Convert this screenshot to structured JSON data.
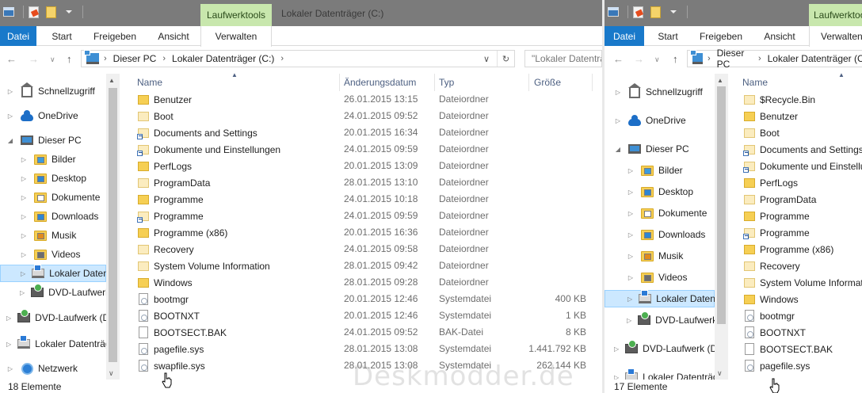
{
  "left": {
    "context_tab": "Laufwerktools",
    "window_title": "Lokaler Datenträger (C:)",
    "ribbon_tabs": [
      "Datei",
      "Start",
      "Freigeben",
      "Ansicht",
      "Verwalten"
    ],
    "breadcrumb": [
      "Dieser PC",
      "Lokaler Datenträger (C:)"
    ],
    "search_placeholder": "\"Lokaler Datenträger (C:)\" durchsuchen",
    "nav": [
      {
        "label": "Schnellzugriff",
        "icon": "home-icon"
      },
      {
        "label": "OneDrive",
        "icon": "onedrive-icon"
      },
      {
        "label": "Dieser PC",
        "icon": "pc-icon"
      },
      {
        "label": "Bilder",
        "icon": "pictures-folder-icon"
      },
      {
        "label": "Desktop",
        "icon": "desktop-folder-icon"
      },
      {
        "label": "Dokumente",
        "icon": "documents-folder-icon"
      },
      {
        "label": "Downloads",
        "icon": "downloads-folder-icon"
      },
      {
        "label": "Musik",
        "icon": "music-folder-icon"
      },
      {
        "label": "Videos",
        "icon": "videos-folder-icon"
      },
      {
        "label": "Lokaler Datenträger (C:)",
        "icon": "drive-icon"
      },
      {
        "label": "DVD-Laufwerk (D:)",
        "icon": "dvd-drive-icon"
      },
      {
        "label": "DVD-Laufwerk (D:)",
        "icon": "dvd-drive-icon"
      },
      {
        "label": "Lokaler Datenträger (C:)",
        "icon": "drive-icon"
      },
      {
        "label": "Netzwerk",
        "icon": "network-icon"
      }
    ],
    "columns": {
      "name": "Name",
      "date": "Änderungsdatum",
      "type": "Typ",
      "size": "Größe"
    },
    "files": [
      {
        "name": "Benutzer",
        "date": "26.01.2015 13:15",
        "type": "Dateiordner",
        "size": "",
        "icon": "folder-icon"
      },
      {
        "name": "Boot",
        "date": "24.01.2015 09:52",
        "type": "Dateiordner",
        "size": "",
        "icon": "folder-pale-icon"
      },
      {
        "name": "Documents and Settings",
        "date": "20.01.2015 16:34",
        "type": "Dateiordner",
        "size": "",
        "icon": "junction-icon"
      },
      {
        "name": "Dokumente und Einstellungen",
        "date": "24.01.2015 09:59",
        "type": "Dateiordner",
        "size": "",
        "icon": "junction-icon"
      },
      {
        "name": "PerfLogs",
        "date": "20.01.2015 13:09",
        "type": "Dateiordner",
        "size": "",
        "icon": "folder-icon"
      },
      {
        "name": "ProgramData",
        "date": "28.01.2015 13:10",
        "type": "Dateiordner",
        "size": "",
        "icon": "folder-pale-icon"
      },
      {
        "name": "Programme",
        "date": "24.01.2015 10:18",
        "type": "Dateiordner",
        "size": "",
        "icon": "folder-icon"
      },
      {
        "name": "Programme",
        "date": "24.01.2015 09:59",
        "type": "Dateiordner",
        "size": "",
        "icon": "junction-icon"
      },
      {
        "name": "Programme (x86)",
        "date": "20.01.2015 16:36",
        "type": "Dateiordner",
        "size": "",
        "icon": "folder-icon"
      },
      {
        "name": "Recovery",
        "date": "24.01.2015 09:58",
        "type": "Dateiordner",
        "size": "",
        "icon": "folder-pale-icon"
      },
      {
        "name": "System Volume Information",
        "date": "28.01.2015 09:42",
        "type": "Dateiordner",
        "size": "",
        "icon": "folder-pale-icon"
      },
      {
        "name": "Windows",
        "date": "28.01.2015 09:28",
        "type": "Dateiordner",
        "size": "",
        "icon": "folder-icon"
      },
      {
        "name": "bootmgr",
        "date": "20.01.2015 12:46",
        "type": "Systemdatei",
        "size": "400 KB",
        "icon": "system-file-icon"
      },
      {
        "name": "BOOTNXT",
        "date": "20.01.2015 12:46",
        "type": "Systemdatei",
        "size": "1 KB",
        "icon": "system-file-icon"
      },
      {
        "name": "BOOTSECT.BAK",
        "date": "24.01.2015 09:52",
        "type": "BAK-Datei",
        "size": "8 KB",
        "icon": "file-icon"
      },
      {
        "name": "pagefile.sys",
        "date": "28.01.2015 13:08",
        "type": "Systemdatei",
        "size": "1.441.792 KB",
        "icon": "system-file-icon"
      },
      {
        "name": "swapfile.sys",
        "date": "28.01.2015 13:08",
        "type": "Systemdatei",
        "size": "262.144 KB",
        "icon": "system-file-icon"
      }
    ],
    "status": "18 Elemente"
  },
  "right": {
    "context_tab": "Laufwerktools",
    "ribbon_tabs": [
      "Datei",
      "Start",
      "Freigeben",
      "Ansicht",
      "Verwalten"
    ],
    "breadcrumb": [
      "Dieser PC",
      "Lokaler Datenträger (C:)"
    ],
    "nav": [
      {
        "label": "Schnellzugriff",
        "icon": "home-icon"
      },
      {
        "label": "OneDrive",
        "icon": "onedrive-icon"
      },
      {
        "label": "Dieser PC",
        "icon": "pc-icon"
      },
      {
        "label": "Bilder",
        "icon": "pictures-folder-icon"
      },
      {
        "label": "Desktop",
        "icon": "desktop-folder-icon"
      },
      {
        "label": "Dokumente",
        "icon": "documents-folder-icon"
      },
      {
        "label": "Downloads",
        "icon": "downloads-folder-icon"
      },
      {
        "label": "Musik",
        "icon": "music-folder-icon"
      },
      {
        "label": "Videos",
        "icon": "videos-folder-icon"
      },
      {
        "label": "Lokaler Datenträger (C:)",
        "icon": "drive-icon"
      },
      {
        "label": "DVD-Laufwerk (D:)",
        "icon": "dvd-drive-icon"
      },
      {
        "label": "DVD-Laufwerk (D:)",
        "icon": "dvd-drive-icon"
      },
      {
        "label": "Lokaler Datenträger (C:)",
        "icon": "drive-icon"
      }
    ],
    "columns": {
      "name": "Name"
    },
    "files": [
      {
        "name": "$Recycle.Bin",
        "icon": "folder-pale-icon"
      },
      {
        "name": "Benutzer",
        "icon": "folder-icon"
      },
      {
        "name": "Boot",
        "icon": "folder-pale-icon"
      },
      {
        "name": "Documents and Settings",
        "icon": "junction-icon"
      },
      {
        "name": "Dokumente und Einstellungen",
        "icon": "junction-icon"
      },
      {
        "name": "PerfLogs",
        "icon": "folder-icon"
      },
      {
        "name": "ProgramData",
        "icon": "folder-pale-icon"
      },
      {
        "name": "Programme",
        "icon": "folder-icon"
      },
      {
        "name": "Programme",
        "icon": "junction-icon"
      },
      {
        "name": "Programme (x86)",
        "icon": "folder-icon"
      },
      {
        "name": "Recovery",
        "icon": "folder-pale-icon"
      },
      {
        "name": "System Volume Information",
        "icon": "folder-pale-icon"
      },
      {
        "name": "Windows",
        "icon": "folder-icon"
      },
      {
        "name": "bootmgr",
        "icon": "system-file-icon"
      },
      {
        "name": "BOOTNXT",
        "icon": "system-file-icon"
      },
      {
        "name": "BOOTSECT.BAK",
        "icon": "file-icon"
      },
      {
        "name": "pagefile.sys",
        "icon": "system-file-icon"
      }
    ],
    "status": "17 Elemente"
  },
  "watermark": "Deskmodder.de",
  "colors": {
    "file_tab": "#1979ca",
    "context_tab": "#c8e7ad",
    "selection": "#cce8ff",
    "title_bar": "#7b7b7b",
    "header_text": "#4d6082"
  }
}
